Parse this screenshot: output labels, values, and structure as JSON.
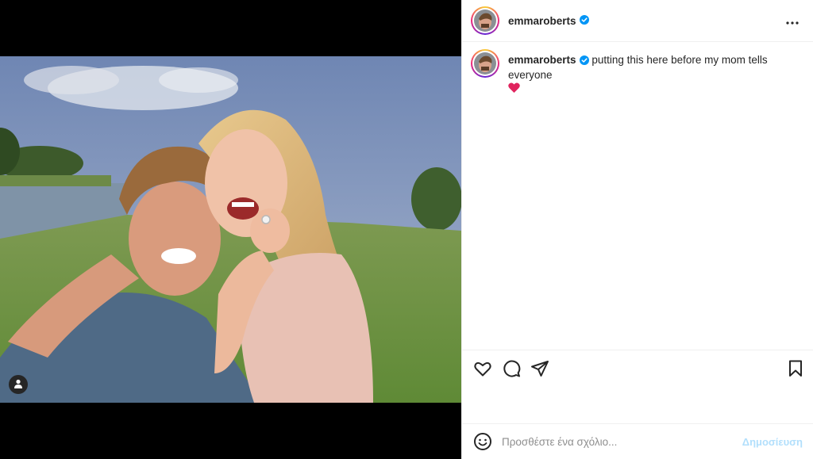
{
  "post": {
    "username": "emmaroberts",
    "verified": true,
    "caption": "putting this here before my mom tells everyone",
    "caption_emoji": "heart-emoji"
  },
  "header": {
    "more_icon": "more-horizontal-icon"
  },
  "actions": {
    "like_icon": "heart-icon",
    "comment_icon": "comment-icon",
    "share_icon": "share-icon",
    "save_icon": "bookmark-icon"
  },
  "comment_box": {
    "placeholder": "Προσθέστε ένα σχόλιο...",
    "post_label": "Δημοσίευση"
  },
  "colors": {
    "verified_blue": "#0095f6",
    "post_button_disabled": "#b2dffc",
    "heart_red": "#e0245e"
  }
}
